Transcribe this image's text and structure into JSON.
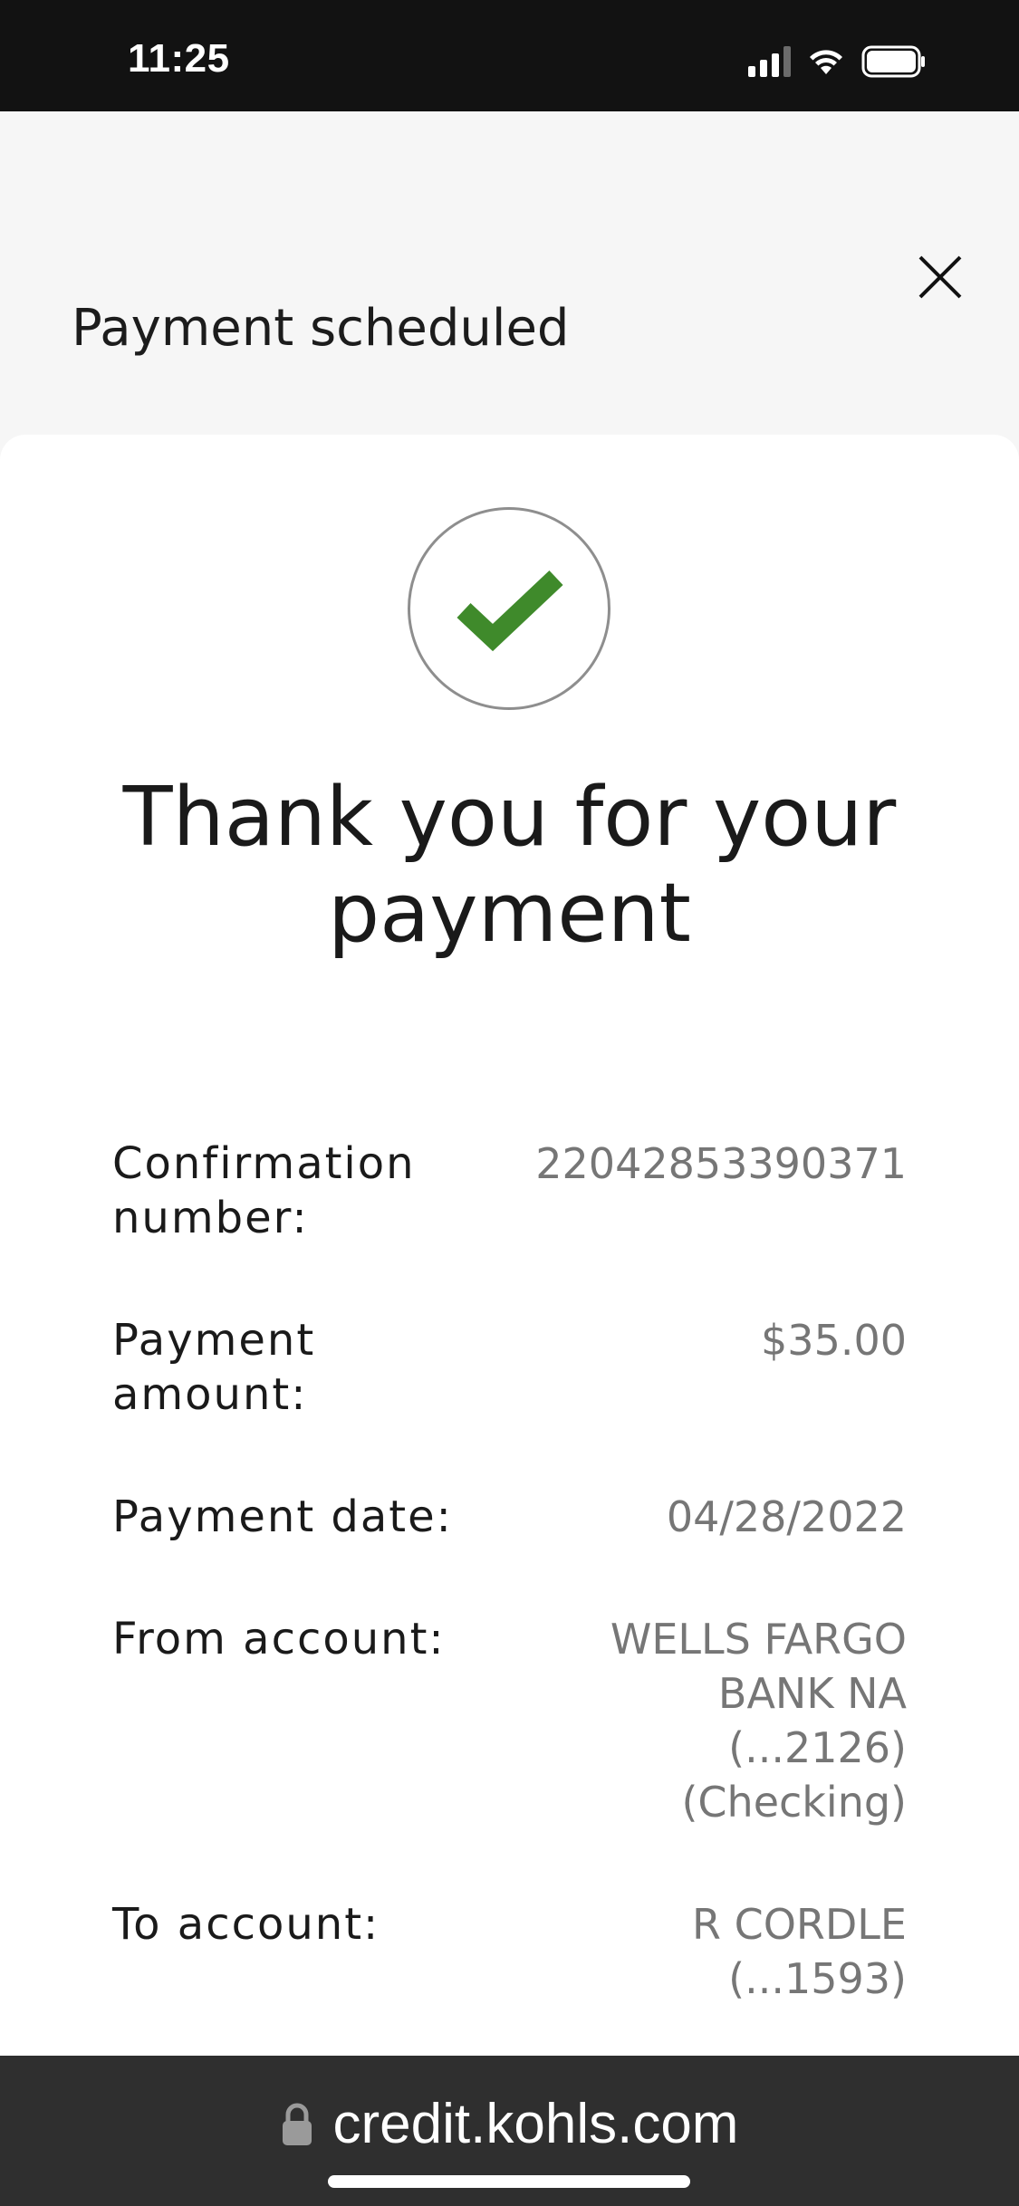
{
  "status_bar": {
    "time": "11:25"
  },
  "header": {
    "title": "Payment scheduled",
    "close_icon": "close-icon"
  },
  "confirmation": {
    "success_icon": "checkmark-icon",
    "success_color": "#3f8a2b",
    "heading_line1": "Thank you for your",
    "heading_line2": "payment"
  },
  "details": [
    {
      "label_line1": "Confirmation",
      "label_line2": "number:",
      "value_lines": [
        "22042853390371"
      ]
    },
    {
      "label_line1": "Payment",
      "label_line2": "amount:",
      "value_lines": [
        "$35.00"
      ]
    },
    {
      "label_line1": "Payment date:",
      "label_line2": "",
      "value_lines": [
        "04/28/2022"
      ]
    },
    {
      "label_line1": "From account:",
      "label_line2": "",
      "value_lines": [
        "WELLS FARGO",
        "BANK NA",
        "(...2126)",
        "(Checking)"
      ]
    },
    {
      "label_line1": "To account:",
      "label_line2": "",
      "value_lines": [
        "R CORDLE",
        "(...1593)"
      ]
    }
  ],
  "browser": {
    "url": "credit.kohls.com",
    "lock_icon": "lock-icon"
  }
}
